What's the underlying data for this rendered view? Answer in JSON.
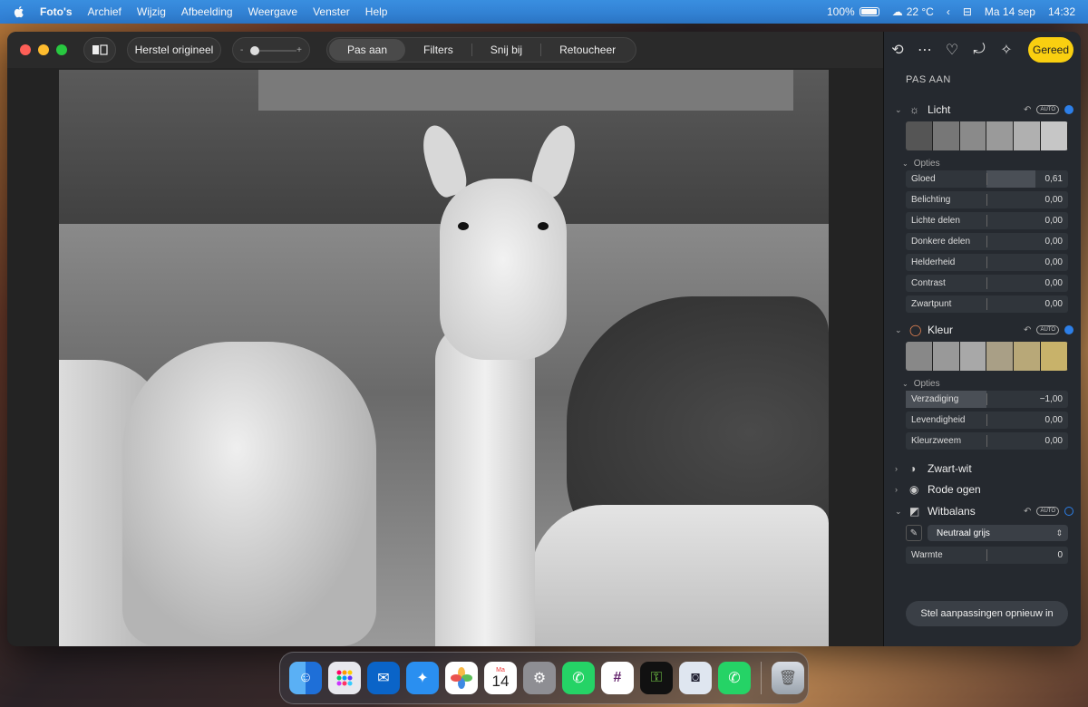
{
  "menubar": {
    "app": "Foto's",
    "items": [
      "Archief",
      "Wijzig",
      "Afbeelding",
      "Weergave",
      "Venster",
      "Help"
    ],
    "battery": "100%",
    "weather": "22 °C",
    "date": "Ma 14 sep",
    "time": "14:32"
  },
  "toolbar": {
    "revert_label": "Herstel origineel",
    "slider_minus": "-",
    "slider_plus": "+",
    "tabs": [
      "Pas aan",
      "Filters",
      "Snij bij",
      "Retoucheer"
    ],
    "active_tab": "Pas aan"
  },
  "sidebar": {
    "done_label": "Gereed",
    "title": "PAS AAN",
    "auto_label": "AUTO",
    "options_label": "Opties",
    "licht": {
      "label": "Licht",
      "sliders": [
        {
          "label": "Gloed",
          "value": "0,61",
          "fill": 0.61
        },
        {
          "label": "Belichting",
          "value": "0,00",
          "fill": 0
        },
        {
          "label": "Lichte delen",
          "value": "0,00",
          "fill": 0
        },
        {
          "label": "Donkere delen",
          "value": "0,00",
          "fill": 0
        },
        {
          "label": "Helderheid",
          "value": "0,00",
          "fill": 0
        },
        {
          "label": "Contrast",
          "value": "0,00",
          "fill": 0
        },
        {
          "label": "Zwartpunt",
          "value": "0,00",
          "fill": 0
        }
      ]
    },
    "kleur": {
      "label": "Kleur",
      "sliders": [
        {
          "label": "Verzadiging",
          "value": "−1,00",
          "fill": -1
        },
        {
          "label": "Levendigheid",
          "value": "0,00",
          "fill": 0
        },
        {
          "label": "Kleurzweem",
          "value": "0,00",
          "fill": 0
        }
      ]
    },
    "zwartwit": "Zwart-wit",
    "rodeogen": "Rode ogen",
    "witbalans": {
      "label": "Witbalans",
      "mode": "Neutraal grijs",
      "warmte_label": "Warmte",
      "warmte_value": "0"
    },
    "reset_label": "Stel aanpassingen opnieuw in"
  },
  "dock": {
    "calendar_month": "Ma",
    "calendar_day": "14",
    "apps": [
      "finder-icon",
      "launchpad-icon",
      "outlook-icon",
      "safari-icon",
      "photos-icon",
      "calendar-icon",
      "settings-icon",
      "whatsapp-icon",
      "slack-icon",
      "1password-icon",
      "copilot-icon",
      "whatsapp-beta-icon",
      "trash-icon"
    ]
  },
  "colors": {
    "accent": "#2d7fe8",
    "done_button": "#f9cf10",
    "menubar": "#2f7fd6"
  }
}
